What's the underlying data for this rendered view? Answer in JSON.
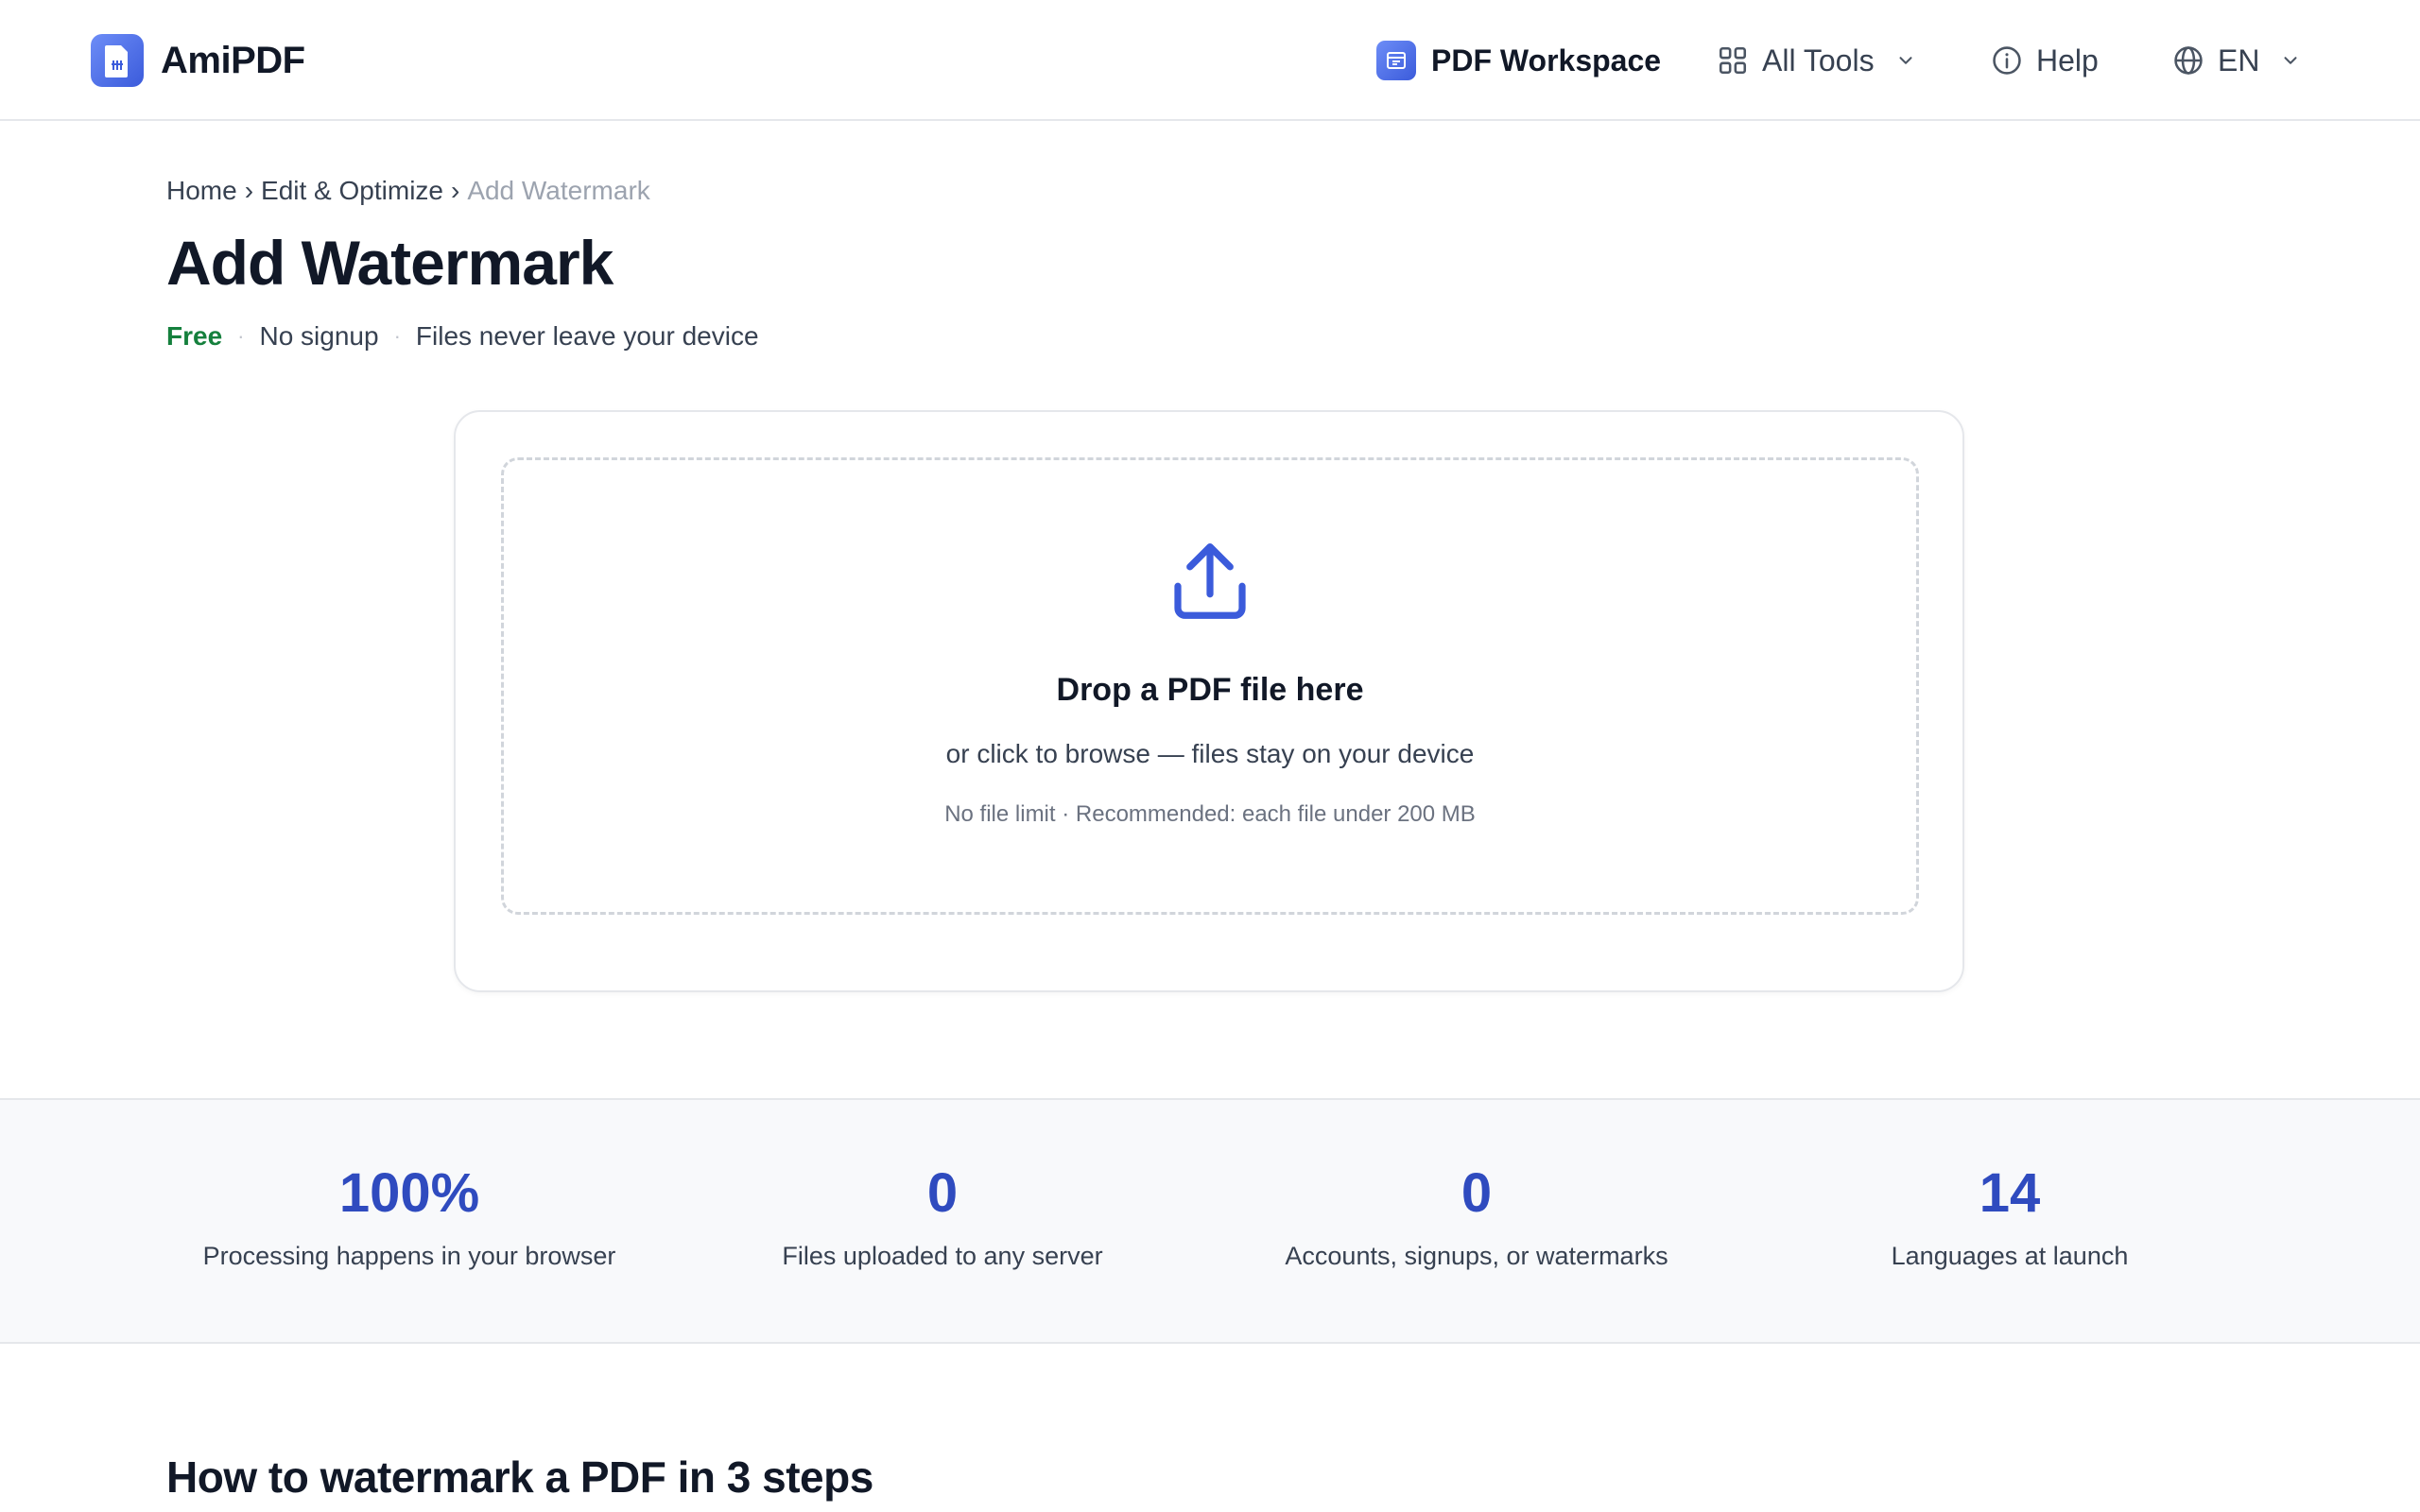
{
  "header": {
    "brand": "AmiPDF",
    "nav": {
      "workspace": "PDF Workspace",
      "all_tools": "All Tools",
      "help": "Help",
      "language": "EN"
    }
  },
  "breadcrumb": {
    "items": [
      "Home",
      "Edit & Optimize"
    ],
    "separator": "›",
    "current": "Add Watermark"
  },
  "page": {
    "title": "Add Watermark",
    "tagline": {
      "free": "Free",
      "no_signup": "No signup",
      "privacy": "Files never leave your device",
      "dot": "·"
    }
  },
  "upload": {
    "title": "Drop a PDF file here",
    "subtitle": "or click to browse — files stay on your device",
    "hint": "No file limit · Recommended: each file under 200 MB",
    "icon": "upload-icon"
  },
  "stats": [
    {
      "value": "100%",
      "label": "Processing happens in your browser"
    },
    {
      "value": "0",
      "label": "Files uploaded to any server"
    },
    {
      "value": "0",
      "label": "Accounts, signups, or watermarks"
    },
    {
      "value": "14",
      "label": "Languages at launch"
    }
  ],
  "steps": {
    "title": "How to watermark a PDF in 3 steps"
  },
  "colors": {
    "accent": "#3b5bdb",
    "stat_number": "#2f4bbf",
    "free_green": "#15803d"
  }
}
